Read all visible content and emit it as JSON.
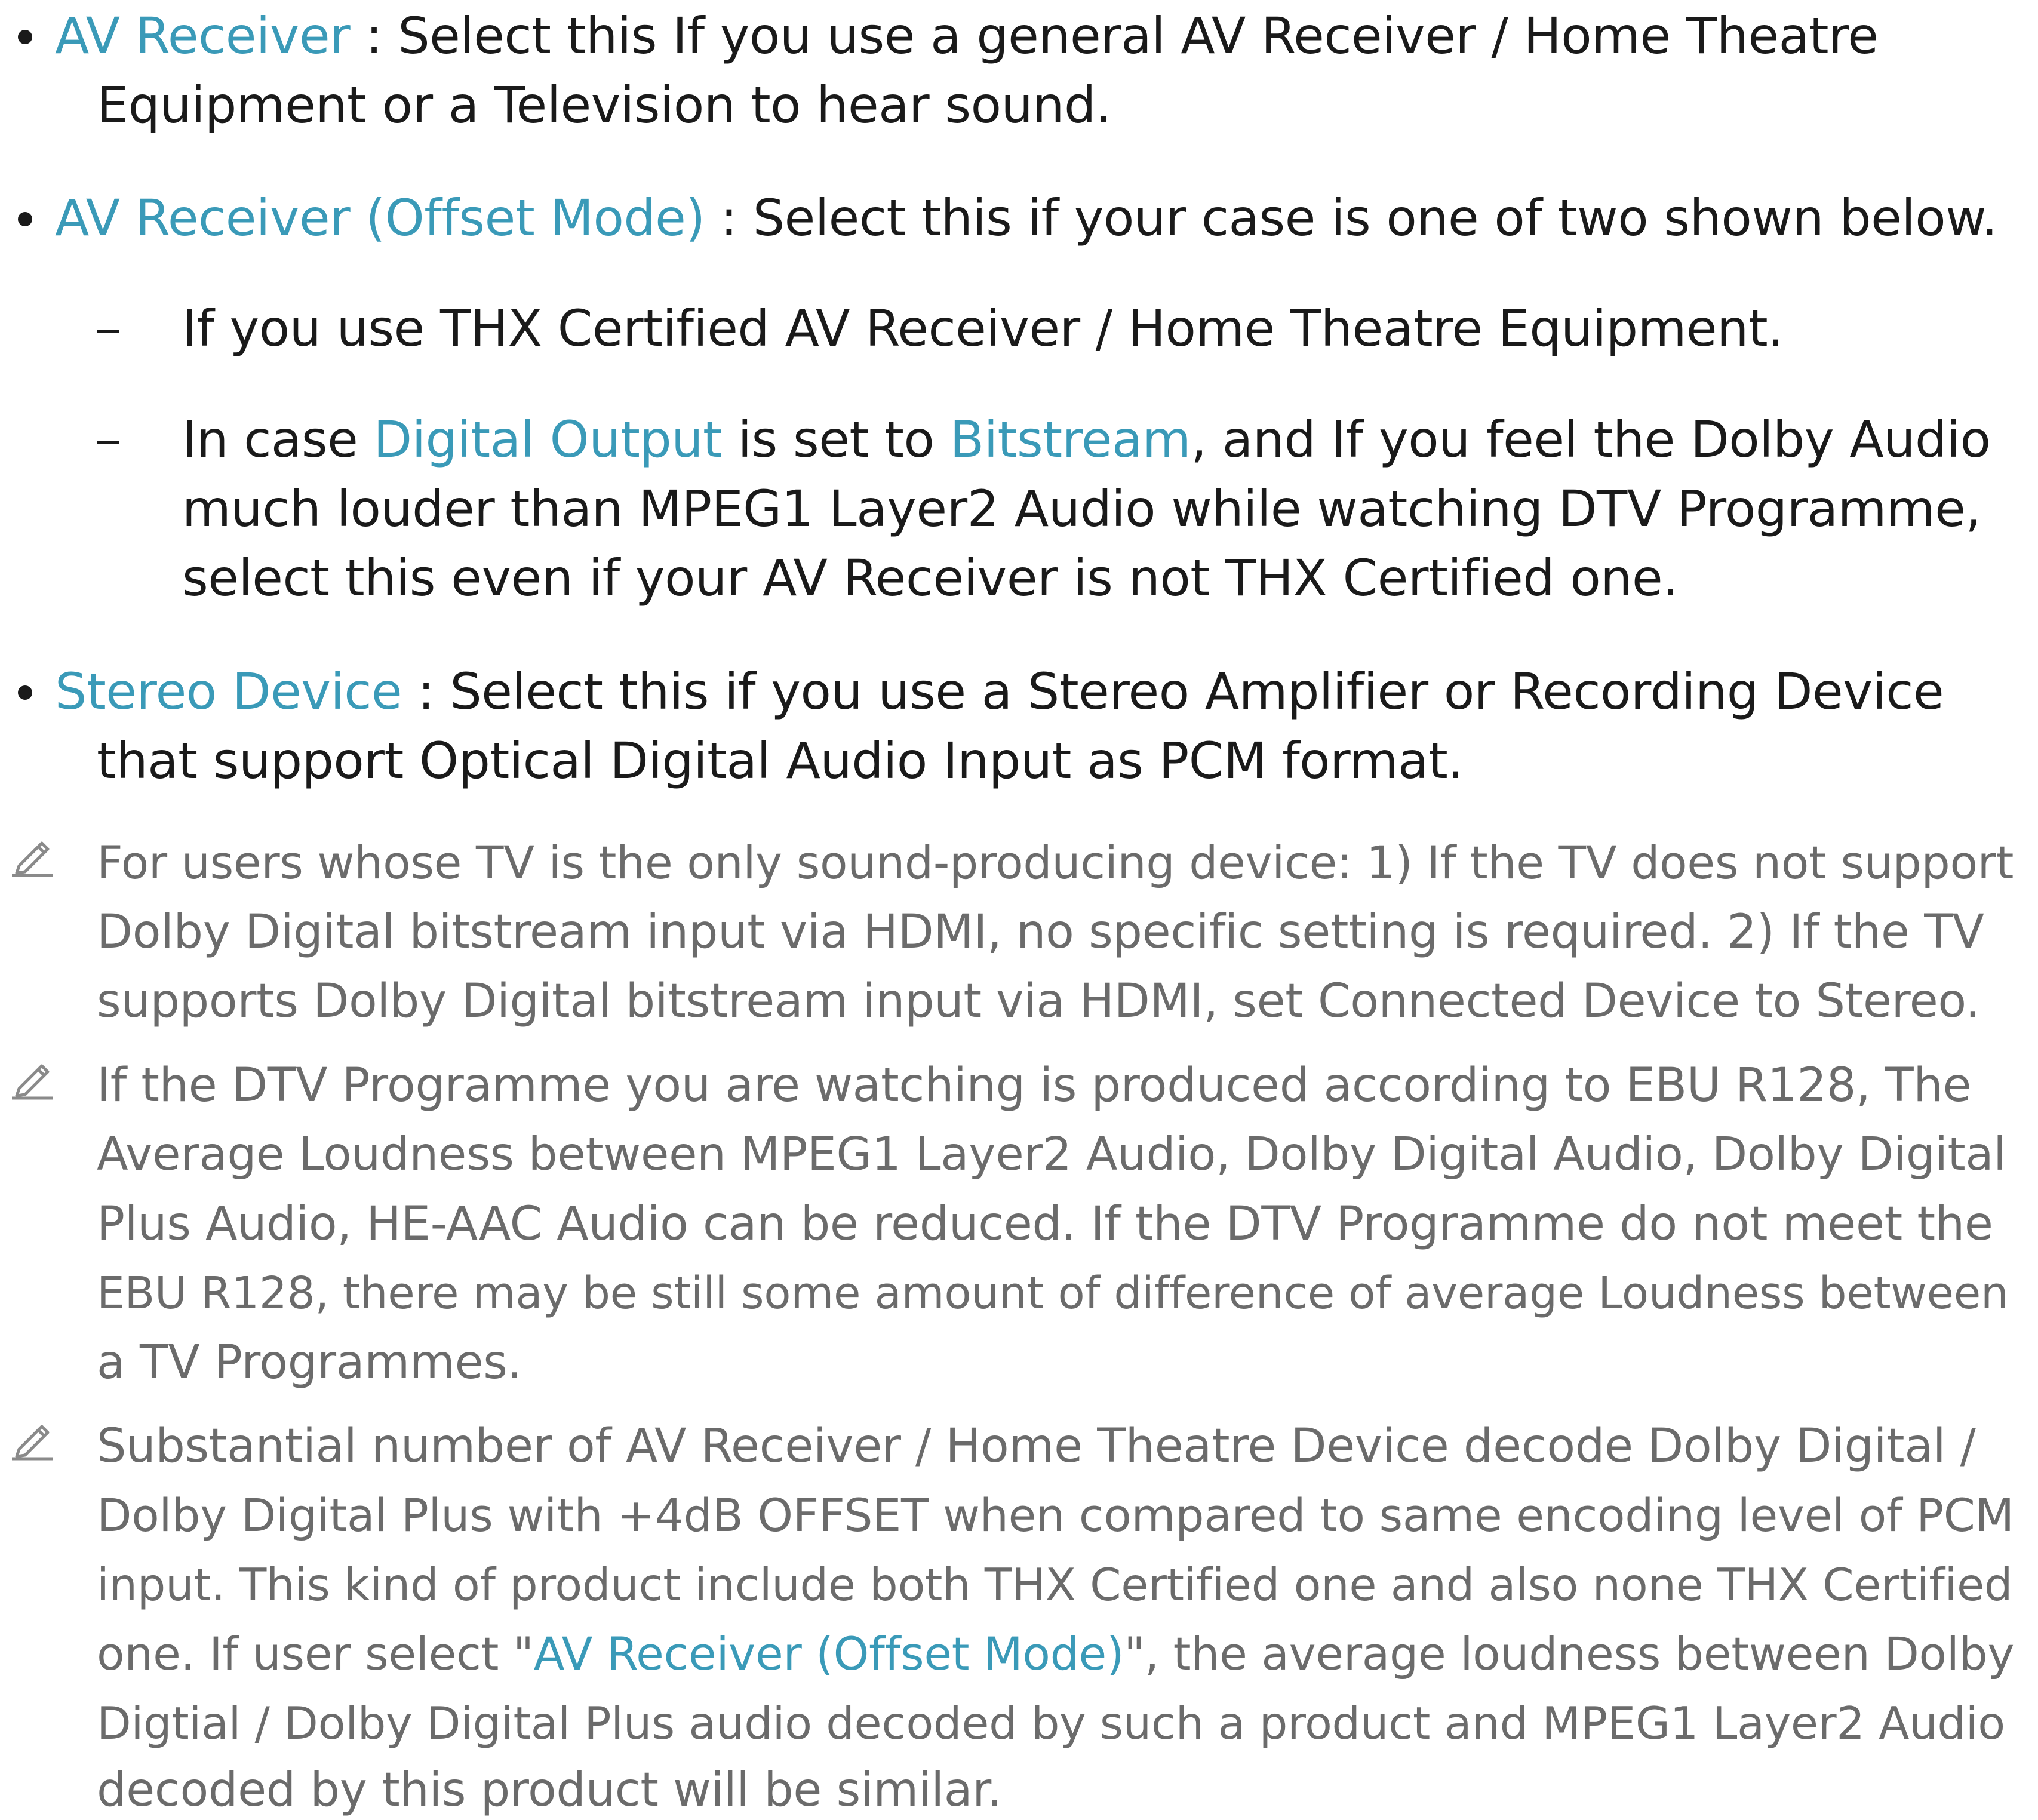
{
  "colors": {
    "highlight": "#3a9ab8",
    "body_text": "#1a1a1a",
    "note_text": "#6b6b6b"
  },
  "bullets": [
    {
      "term": "AV Receiver",
      "sep": " : ",
      "line1": "Select this If you use a general AV Receiver / Home Theatre",
      "line2": "Equipment or a Television to hear sound."
    },
    {
      "term": "AV Receiver (Offset Mode)",
      "sep": " : ",
      "line1": "Select this if your case is one of two shown below."
    },
    {
      "term": "Stereo Device",
      "sep": " : ",
      "line1": "Select this if you use a Stereo Amplifier or Recording Device",
      "line2": "that support Optical Digital Audio Input as PCM format."
    }
  ],
  "sub_items": {
    "item1": "If you use THX Certified AV Receiver / Home Theatre Equipment.",
    "item2_a": "In case ",
    "item2_term1": "Digital Output",
    "item2_b": " is set to ",
    "item2_term2": "Bitstream",
    "item2_c": ", and If you feel the Dolby Audio",
    "item2_line2": "much louder than MPEG1 Layer2 Audio while watching DTV Programme,",
    "item2_line3": "select this even if your AV Receiver is not THX Certified one."
  },
  "notes": {
    "note1": [
      "For users whose TV is the only sound-producing device: 1) If the TV does not support",
      "Dolby Digital bitstream input via HDMI, no specific setting is required. 2) If the TV",
      "supports Dolby Digital bitstream input via HDMI, set Connected Device to Stereo."
    ],
    "note2": [
      "If the DTV Programme you are watching is produced according to EBU R128, The",
      "Average Loudness between MPEG1 Layer2 Audio, Dolby Digital Audio, Dolby Digital",
      "Plus Audio, HE-AAC Audio can be reduced. If the DTV Programme do not meet the",
      "EBU R128, there may be still some amount of difference of average Loudness between",
      "a TV Programmes."
    ],
    "note3": {
      "line1": "Substantial number of AV Receiver / Home Theatre Device decode Dolby Digital /",
      "line2": "Dolby Digital Plus with +4dB OFFSET when compared to same encoding level of PCM",
      "line3": "input. This kind of product include both THX Certified one and also none THX Certified",
      "line4_a": "one. If user select \"",
      "line4_term": "AV Receiver (Offset Mode)",
      "line4_b": "\", the average loudness between Dolby",
      "line5": "Digtial / Dolby Digital Plus audio decoded by such a product and MPEG1 Layer2 Audio",
      "line6": "decoded by this product will be similar."
    }
  },
  "icons": {
    "bullet": "bullet-dot",
    "dash": "dash",
    "note": "pencil-icon"
  }
}
